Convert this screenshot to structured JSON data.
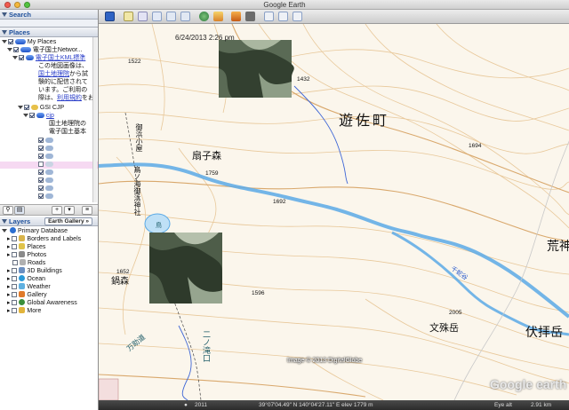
{
  "window": {
    "title": "Google Earth"
  },
  "sidebar": {
    "search_label": "Search",
    "places_label": "Places",
    "layers_label": "Layers",
    "earth_gallery_label": "Earth Gallery",
    "earth_gallery_chevron": "»",
    "places": {
      "my_places": "My Places",
      "network_link": "電子国土Networ...",
      "kml_link": "電子国土KML標準",
      "desc_line1": "この地図画像は、",
      "desc_link1": "国土地理院",
      "desc_line2_tail": "から試",
      "desc_line3": "験的に配信されて",
      "desc_line4": "います。ご利用の",
      "desc_line5_head": "際は、",
      "desc_link2": "利用規約",
      "desc_line5_tail": "をお",
      "gsi_folder": "GSI CJP",
      "cjp_link": "cjp",
      "cjp_desc1": "国土地理院の",
      "cjp_desc2": "電子国土基本"
    },
    "layers": [
      {
        "label": "Primary Database",
        "color": "#2c6fd1"
      },
      {
        "label": "Borders and Labels",
        "color": "#d9b44a"
      },
      {
        "label": "Places",
        "color": "#e0c34a"
      },
      {
        "label": "Photos",
        "color": "#8a8a8a"
      },
      {
        "label": "Roads",
        "color": "#b0b0b0"
      },
      {
        "label": "3D Buildings",
        "color": "#6a8fc1"
      },
      {
        "label": "Ocean",
        "color": "#2a9ad8"
      },
      {
        "label": "Weather",
        "color": "#5fb0e0"
      },
      {
        "label": "Gallery",
        "color": "#e07a2a"
      },
      {
        "label": "Global Awareness",
        "color": "#3b8f3b"
      },
      {
        "label": "More",
        "color": "#e2b43c"
      }
    ]
  },
  "map": {
    "date_overlay": "6/24/2013 2:26 pm",
    "town": "遊佐町",
    "peak_ogimori": "扇子森",
    "peak_kabutomori": "鍋森",
    "peak_monju": "文殊岳",
    "peak_fushi": "伏拝岳",
    "peak_ara": "荒神",
    "hut": "御浜小屋",
    "shrine": "鳥ノ海御浜神社",
    "trail1": "千蛇谷",
    "trail2": "万助道",
    "trail3": "二ノ滝口",
    "lake": "鳥",
    "elevations": [
      "1522",
      "1432",
      "1694",
      "1759",
      "1692",
      "1652",
      "1596",
      "2005"
    ],
    "attribution": "Image © 2013 DigitalGlobe",
    "brand": "Google earth"
  },
  "status": {
    "year": "2011",
    "coords": "39°07'04.49\" N 140°04'27.11\" E elev 1779 m",
    "eye": "Eye alt",
    "eye_value": "2.91 km"
  }
}
